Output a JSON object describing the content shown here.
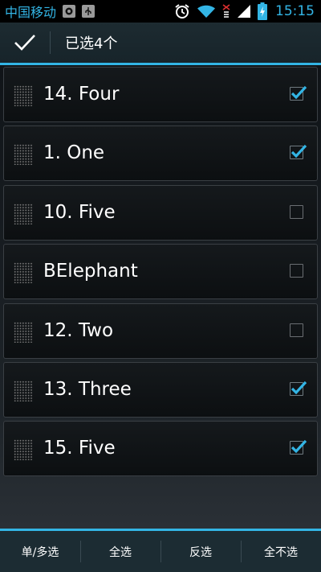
{
  "status_bar": {
    "carrier": "中国移动",
    "time": "15:15",
    "icons": [
      "notification-icon",
      "usb-icon",
      "alarm-icon",
      "wifi-icon",
      "no-sim-icon",
      "signal-icon",
      "battery-charging-icon"
    ]
  },
  "action_bar": {
    "title": "已选4个",
    "done_icon": "check-icon"
  },
  "list": {
    "items": [
      {
        "label": "14. Four",
        "checked": true
      },
      {
        "label": "1. One",
        "checked": true
      },
      {
        "label": "10. Five",
        "checked": false
      },
      {
        "label": "BElephant",
        "checked": false
      },
      {
        "label": "12. Two",
        "checked": false
      },
      {
        "label": "13. Three",
        "checked": true
      },
      {
        "label": "15. Five",
        "checked": true
      }
    ]
  },
  "bottom_bar": {
    "single_multi": "单/多选",
    "select_all": "全选",
    "invert": "反选",
    "select_none": "全不选"
  },
  "colors": {
    "accent": "#33b5e5",
    "action_bar": "#1d2b31",
    "background": "#101418"
  }
}
